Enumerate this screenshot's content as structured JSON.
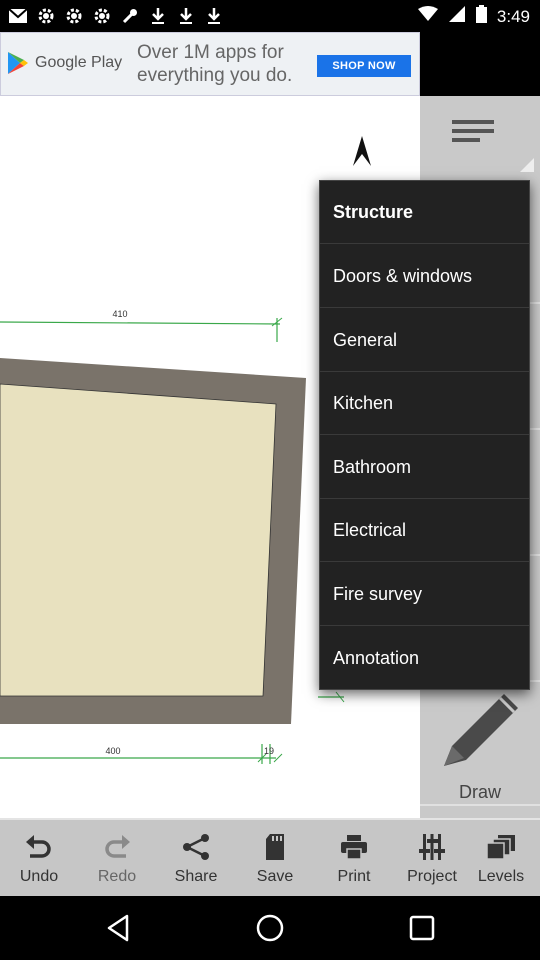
{
  "status_bar": {
    "time": "3:49",
    "notification_icons": [
      "gmail-icon",
      "settings-icon",
      "settings-icon",
      "settings-icon",
      "wrench-icon",
      "download-icon",
      "download-icon",
      "download-icon"
    ]
  },
  "ad": {
    "brand": "Google Play",
    "headline": "Over 1M apps for everything you do.",
    "cta": "SHOP NOW"
  },
  "canvas": {
    "dimension_top": "410",
    "dimension_bottom": "400",
    "dimension_side_right": "19"
  },
  "menu": {
    "items": [
      {
        "label": "Structure"
      },
      {
        "label": "Doors & windows"
      },
      {
        "label": "General"
      },
      {
        "label": "Kitchen"
      },
      {
        "label": "Bathroom"
      },
      {
        "label": "Electrical"
      },
      {
        "label": "Fire survey"
      },
      {
        "label": "Annotation"
      }
    ]
  },
  "side_panel": {
    "draw_label": "Draw"
  },
  "toolbar": {
    "buttons": [
      {
        "label": "Undo",
        "icon": "undo-icon"
      },
      {
        "label": "Redo",
        "icon": "redo-icon"
      },
      {
        "label": "Share",
        "icon": "share-icon"
      },
      {
        "label": "Save",
        "icon": "sd-card-icon"
      },
      {
        "label": "Print",
        "icon": "printer-icon"
      },
      {
        "label": "Project",
        "icon": "sliders-icon"
      },
      {
        "label": "Levels",
        "icon": "levels-icon"
      }
    ]
  },
  "colors": {
    "menu_bg": "#222222",
    "toolbar_bg": "#c6c6c6",
    "room_fill": "#e8e1bf",
    "wall_fill": "#7a736a",
    "dimension_line": "#3aa84a",
    "ad_button": "#1a73e8"
  }
}
